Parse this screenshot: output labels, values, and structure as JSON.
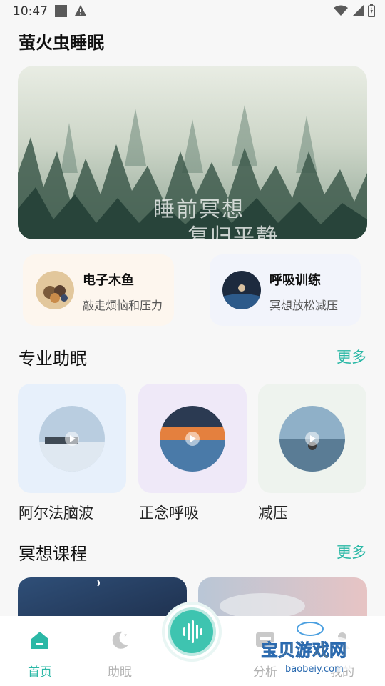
{
  "status": {
    "time": "10:47"
  },
  "app": {
    "title": "萤火虫睡眠"
  },
  "banner": {
    "line1": "睡前冥想",
    "line2": "复归平静"
  },
  "quick_cards": [
    {
      "title": "电子木鱼",
      "subtitle": "敲走烦恼和压力"
    },
    {
      "title": "呼吸训练",
      "subtitle": "冥想放松减压"
    }
  ],
  "sections": {
    "pro": {
      "title": "专业助眠",
      "more": "更多",
      "items": [
        {
          "label": "阿尔法脑波"
        },
        {
          "label": "正念呼吸"
        },
        {
          "label": "减压"
        }
      ]
    },
    "course": {
      "title": "冥想课程",
      "more": "更多"
    }
  },
  "tabbar": {
    "items": [
      {
        "label": "首页",
        "icon": "home-icon",
        "active": true
      },
      {
        "label": "助眠",
        "icon": "moon-icon",
        "active": false
      },
      {
        "label": "分析",
        "icon": "analysis-icon",
        "active": false
      },
      {
        "label": "我的",
        "icon": "profile-icon",
        "active": false
      }
    ],
    "center_icon": "soundwave-icon"
  },
  "watermark": {
    "text": "宝贝游戏网",
    "url_text": "baobeiy.com"
  },
  "colors": {
    "accent": "#2bb8a6",
    "tab_inactive": "#b0b0b0"
  }
}
